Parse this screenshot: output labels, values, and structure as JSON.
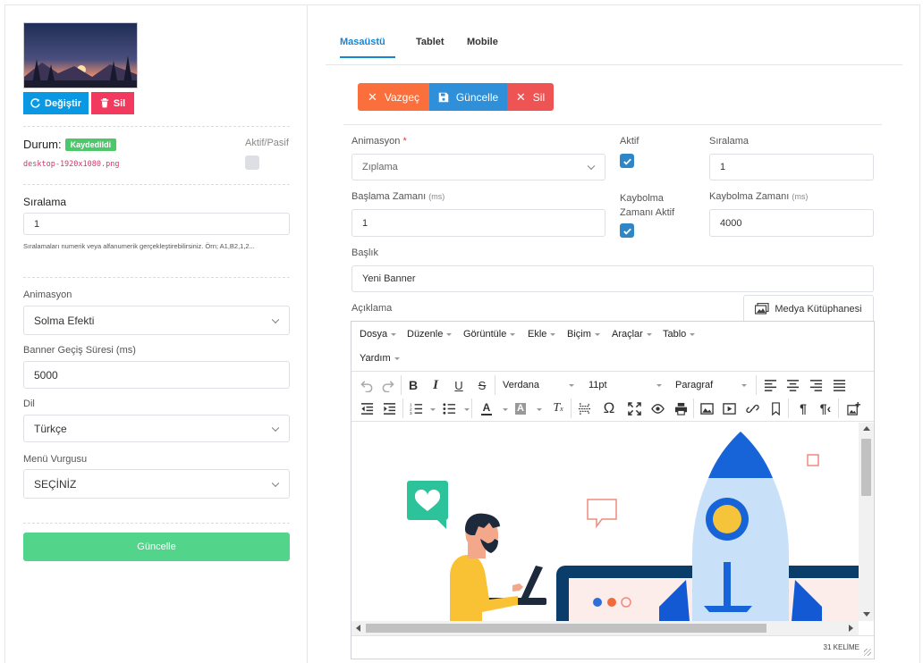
{
  "left": {
    "change_button": "Değiştir",
    "delete_button": "Sil",
    "status_label": "Durum:",
    "status_badge": "Kaydedildi",
    "filename": "desktop-1920x1080.png",
    "active_passive_label": "Aktif/Pasif",
    "order_label": "Sıralama",
    "order_value": "1",
    "order_help": "Sıralamaları numerik veya alfanumerik gerçekleştirebilirsiniz. Örn; A1,B2,1,2...",
    "animation_label": "Animasyon",
    "animation_value": "Solma Efekti",
    "transition_label": "Banner Geçiş Süresi (ms)",
    "transition_value": "5000",
    "language_label": "Dil",
    "language_value": "Türkçe",
    "menu_highlight_label": "Menü Vurgusu",
    "menu_highlight_value": "SEÇİNİZ",
    "update_button": "Güncelle"
  },
  "tabs": [
    "Masaüstü",
    "Tablet",
    "Mobile"
  ],
  "actions": {
    "cancel": "Vazgeç",
    "update": "Güncelle",
    "delete": "Sil"
  },
  "form": {
    "animation_label": "Animasyon",
    "required_mark": "*",
    "animation_value": "Zıplama",
    "active_label": "Aktif",
    "order_label": "Sıralama",
    "order_value": "1",
    "start_label": "Başlama Zamanı",
    "start_unit": "(ms)",
    "start_value": "1",
    "fade_active_label_1": "Kaybolma",
    "fade_active_label_2": "Zamanı Aktif",
    "fade_time_label": "Kaybolma Zamanı",
    "fade_time_unit": "(ms)",
    "fade_time_value": "4000",
    "title_label": "Başlık",
    "title_value": "Yeni Banner",
    "description_label": "Açıklama",
    "media_library_button": "Medya Kütüphanesi"
  },
  "editor": {
    "menus": [
      "Dosya",
      "Düzenle",
      "Görüntüle",
      "Ekle",
      "Biçim",
      "Araçlar",
      "Tablo"
    ],
    "menu_help": "Yardım",
    "font_family": "Verdana",
    "font_size": "11pt",
    "block_format": "Paragraf",
    "word_count": "31 KELİME"
  },
  "colors": {
    "primary": "#0b98e3",
    "danger": "#f23a5e",
    "success_badge": "#4cc76a",
    "update_green": "#52d48a",
    "orange": "#fb6f3c",
    "blue": "#2f8fd8",
    "red": "#ef5455",
    "tab_active": "#1486d4"
  }
}
